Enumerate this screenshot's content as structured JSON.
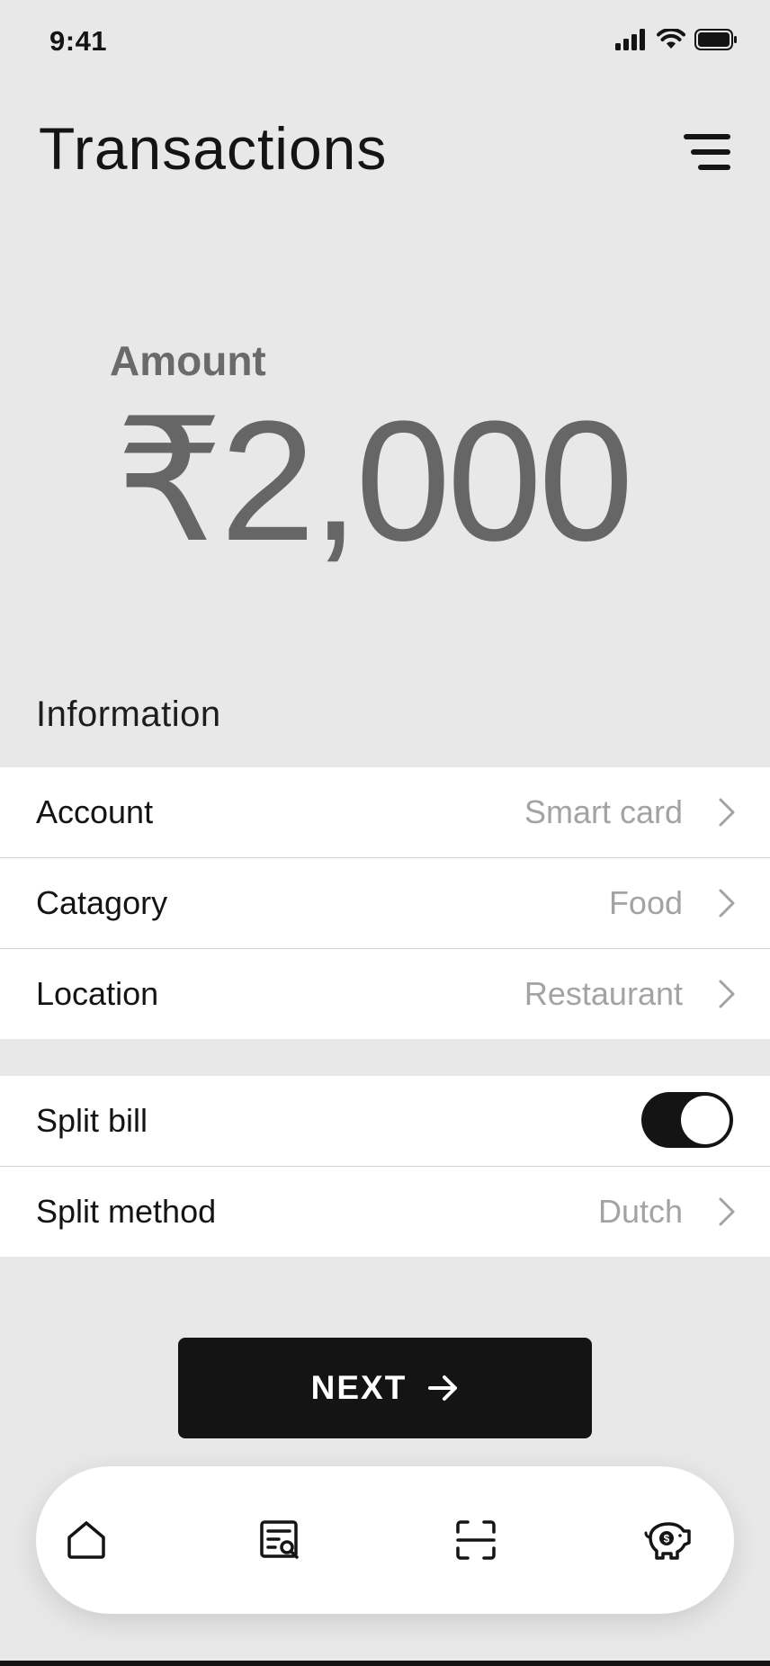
{
  "status_bar": {
    "time": "9:41",
    "icons": [
      "signal-icon",
      "wifi-icon",
      "battery-icon"
    ]
  },
  "header": {
    "title": "Transactions",
    "menu_icon": "menu-icon"
  },
  "amount": {
    "label": "Amount",
    "value": "₹2,000"
  },
  "information": {
    "title": "Information",
    "rows": [
      {
        "label": "Account",
        "value": "Smart card"
      },
      {
        "label": "Catagory",
        "value": "Food"
      },
      {
        "label": "Location",
        "value": "Restaurant"
      }
    ]
  },
  "split": {
    "toggle_label": "Split bill",
    "toggle_on": true,
    "method_label": "Split method",
    "method_value": "Dutch"
  },
  "next_button": {
    "label": "NEXT",
    "icon": "arrow-right-icon"
  },
  "tab_bar": {
    "items": [
      "home-icon",
      "search-document-icon",
      "scan-icon",
      "piggy-bank-icon"
    ]
  },
  "colors": {
    "background": "#e8e8e8",
    "dark": "#141414",
    "muted": "#a3a3a3",
    "amount": "#666666"
  }
}
